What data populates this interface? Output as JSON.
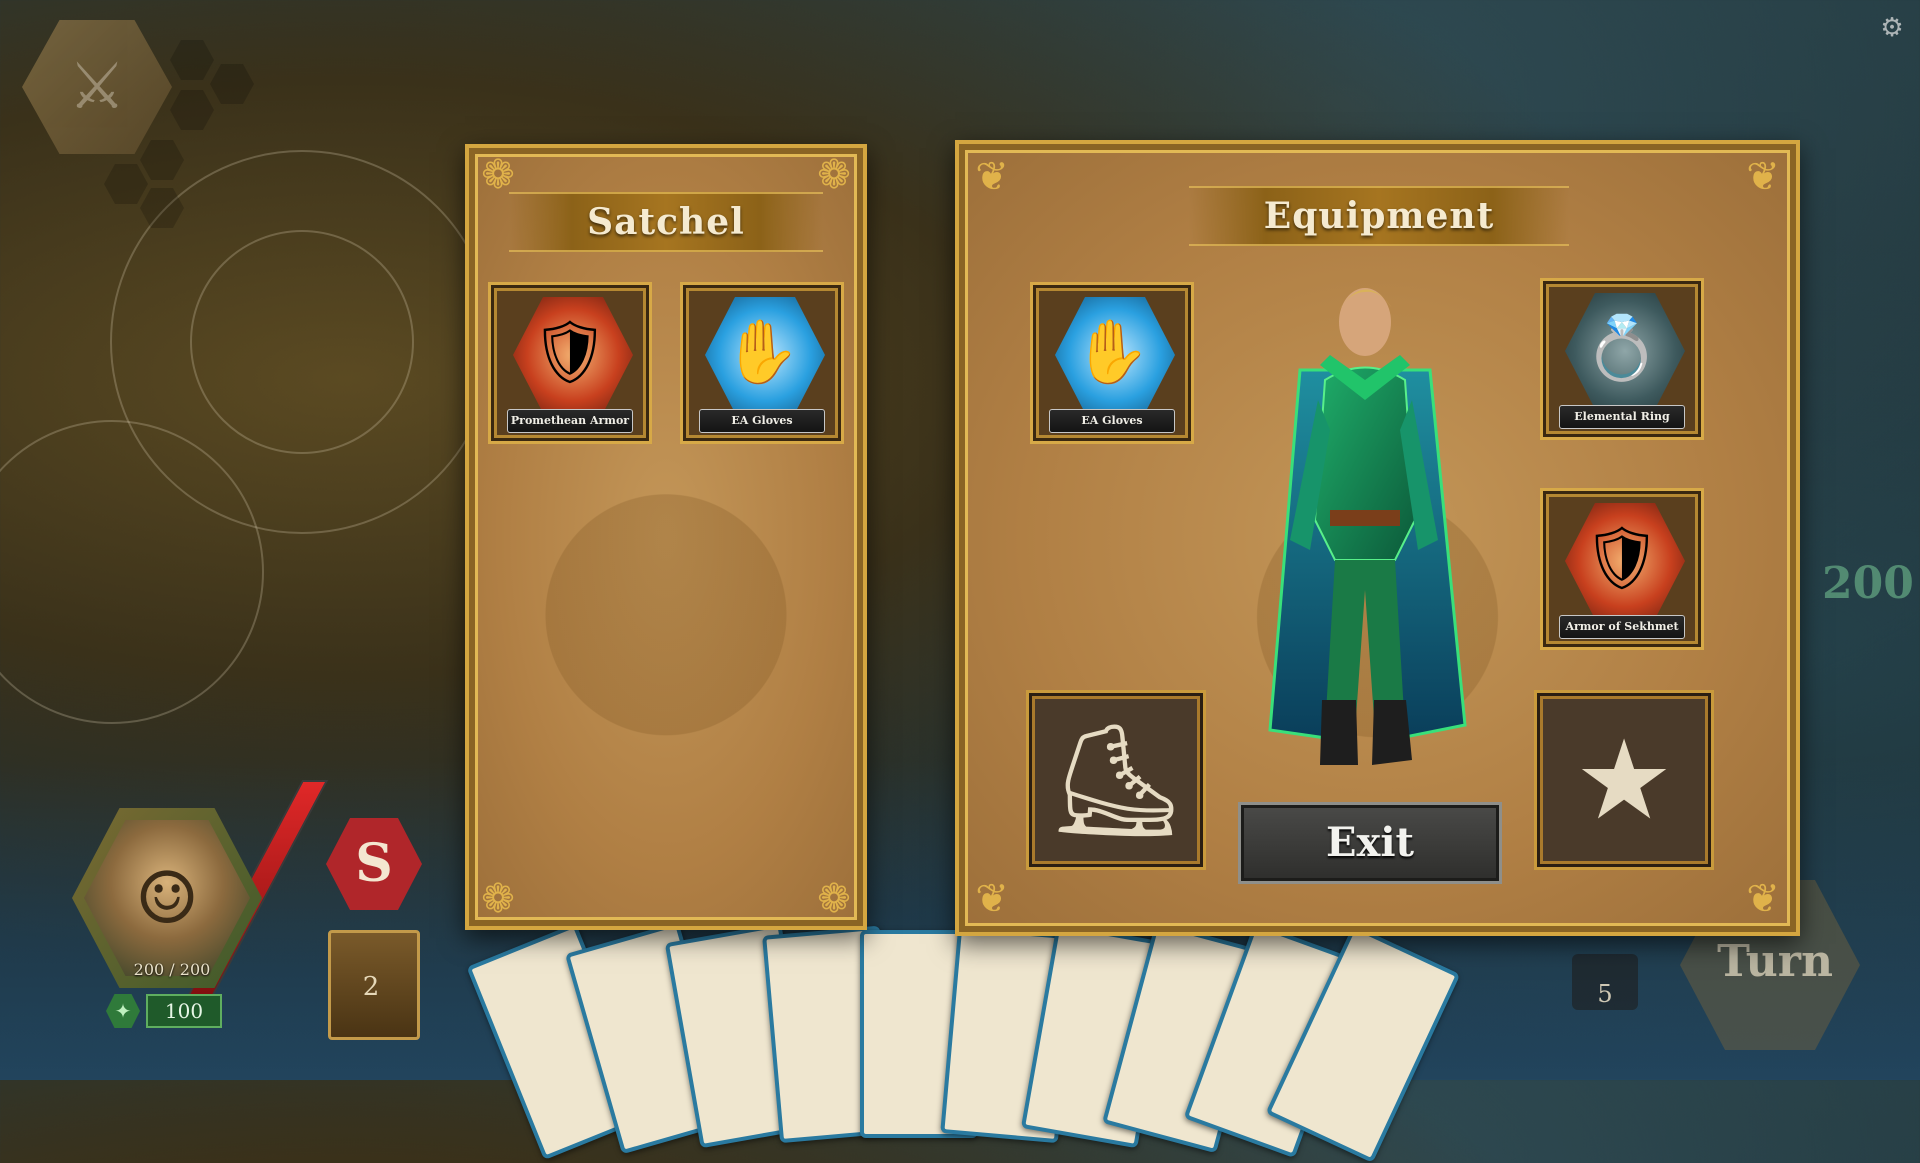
{
  "satchel": {
    "title": "Satchel",
    "items": [
      {
        "name": "Promethean Armor",
        "icon": "armor-icon"
      },
      {
        "name": "EA Gloves",
        "icon": "gauntlet-icon"
      }
    ]
  },
  "equipment": {
    "title": "Equipment",
    "slots": {
      "hands": {
        "name": "EA Gloves",
        "icon": "gauntlet-icon"
      },
      "ring": {
        "name": "Elemental Ring",
        "icon": "ring-icon"
      },
      "armor": {
        "name": "Armor of Sekhmet",
        "icon": "armor-icon"
      },
      "boots": {
        "empty": true,
        "icon": "boot-icon"
      },
      "trinket": {
        "empty": true,
        "icon": "star-icon"
      }
    },
    "exit_label": "Exit"
  },
  "hud": {
    "health": "200 / 200",
    "mana": "100",
    "deck_count": "2",
    "discard_count": "5",
    "class_badge": "S",
    "turn_label": "Turn",
    "enemy_hp": "200"
  },
  "colors": {
    "gold": "#d4a640",
    "parchment": "#b07f44",
    "button": "#3a3a38"
  }
}
